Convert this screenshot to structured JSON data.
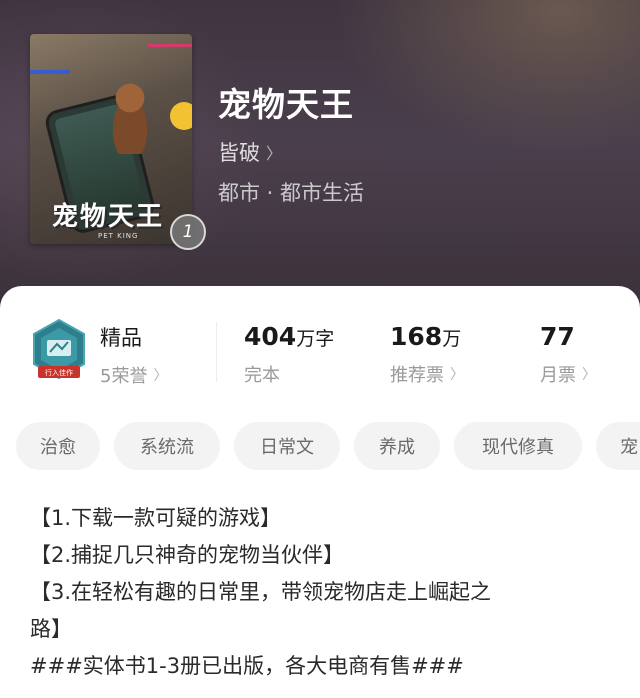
{
  "book": {
    "cover_title": "宠物天王",
    "cover_subtitle": "PET KING",
    "volume_badge": "1",
    "title": "宠物天王",
    "author": "皆破",
    "category": "都市 · 都市生活"
  },
  "stats": {
    "honor": {
      "label": "精品",
      "sub": "5荣誉",
      "badge_text": "行入佳作"
    },
    "words": {
      "value": "404",
      "unit": "万字",
      "sub": "完本"
    },
    "recommend": {
      "value": "168",
      "unit": "万",
      "sub": "推荐票"
    },
    "monthly": {
      "value": "77",
      "sub": "月票"
    }
  },
  "tags": [
    "治愈",
    "系统流",
    "日常文",
    "养成",
    "现代修真",
    "宠"
  ],
  "description": [
    "【1.下载一款可疑的游戏】",
    "【2.捕捉几只神奇的宠物当伙伴】",
    "【3.在轻松有趣的日常里，带领宠物店走上崛起之",
    "路】",
    "###实体书1-3册已出版，各大电商有售###"
  ]
}
